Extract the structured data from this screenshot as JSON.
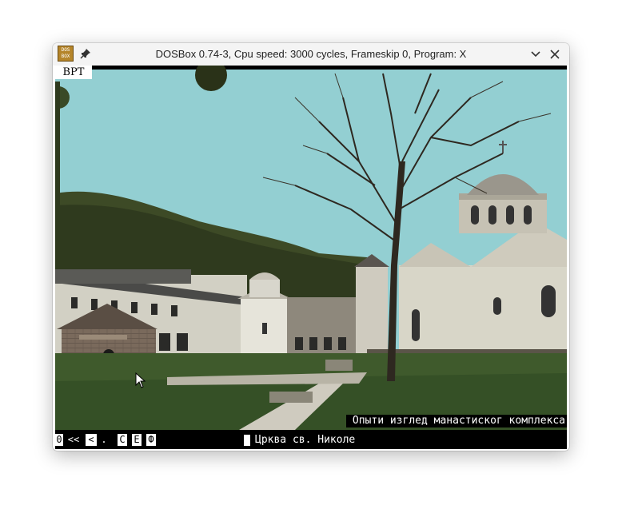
{
  "window": {
    "title": "DOSBox 0.74-3, Cpu speed: 3000 cycles, Frameskip 0, Program: X",
    "app_icon_text": "DOS BOX"
  },
  "screen": {
    "top_label": "ВРТ",
    "caption": "Опыти изглед манастиског комплекса",
    "church_title": "Црква св. Николе",
    "controls": [
      "0",
      "<<",
      "<",
      ".",
      "C",
      "E",
      "Ф"
    ]
  },
  "colors": {
    "sky": "#93cfd2",
    "hill": "#3d4a26",
    "grass": "#3f5a2c",
    "stone": "#d8d6c8"
  },
  "icons": [
    "dosbox-app-icon",
    "pin-icon",
    "minimize-chevron-icon",
    "close-icon",
    "mouse-pointer-icon"
  ]
}
